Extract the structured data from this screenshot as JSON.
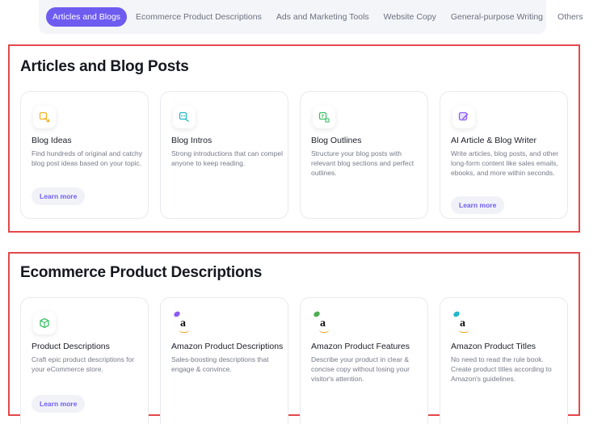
{
  "tabs": [
    {
      "label": "Articles and Blogs",
      "active": true
    },
    {
      "label": "Ecommerce Product Descriptions",
      "active": false
    },
    {
      "label": "Ads and Marketing Tools",
      "active": false
    },
    {
      "label": "Website Copy",
      "active": false
    },
    {
      "label": "General-purpose Writing",
      "active": false
    },
    {
      "label": "Others",
      "active": false
    }
  ],
  "articles": {
    "title": "Articles and Blog Posts",
    "cards": [
      {
        "title": "Blog Ideas",
        "desc": "Find hundreds of original and catchy blog post ideas based on your topic.",
        "button": "Learn more",
        "icon": "idea-arrow-icon",
        "icon_color": "#f0b324"
      },
      {
        "title": "Blog Intros",
        "desc": "Strong introductions that can compel anyone to keep reading.",
        "button": "",
        "icon": "intro-arrow-icon",
        "icon_color": "#22b8c8"
      },
      {
        "title": "Blog Outlines",
        "desc": "Structure your blog posts with relevant blog sections and perfect outlines.",
        "button": "",
        "icon": "outline-grid-icon",
        "icon_color": "#3fbf6a"
      },
      {
        "title": "AI Article & Blog Writer",
        "desc": "Write articles, blog posts, and other long-form content like sales emails, ebooks, and more within seconds.",
        "button": "Learn more",
        "icon": "pen-writer-icon",
        "icon_color": "#8b5cf0"
      }
    ]
  },
  "ecommerce": {
    "title": "Ecommerce Product Descriptions",
    "cards": [
      {
        "title": "Product Descriptions",
        "desc": "Craft epic product descriptions for your eCommerce store.",
        "button": "Learn more",
        "icon": "cube-icon",
        "icon_color": "#3fbf6a"
      },
      {
        "title": "Amazon Product Descriptions",
        "desc": "Sales-boosting descriptions that engage & convince.",
        "button": "",
        "icon": "amazon-logo-icon",
        "icon_color": "#8b5cf0"
      },
      {
        "title": "Amazon Product Features",
        "desc": "Describe your product in clear & concise copy without losing your visitor's attention.",
        "button": "",
        "icon": "amazon-logo-icon",
        "icon_color": "#4cae4f"
      },
      {
        "title": "Amazon Product Titles",
        "desc": "No need to read the rule book. Create product titles according to Amazon's guidelines.",
        "button": "",
        "icon": "amazon-logo-icon",
        "icon_color": "#22b8c8"
      }
    ]
  },
  "colors": {
    "accent": "#6e5cf0",
    "highlight_border": "#e4484a"
  }
}
